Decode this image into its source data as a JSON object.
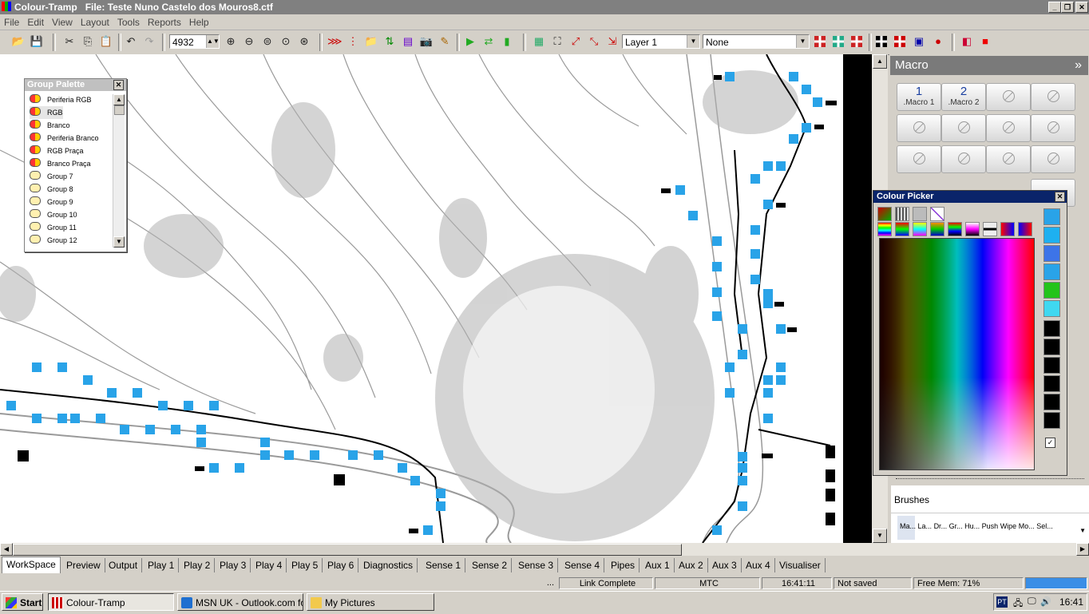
{
  "window": {
    "app_name": "Colour-Tramp",
    "file_label": "File: Teste Nuno Castelo dos Mouros8.ctf"
  },
  "menu": [
    "File",
    "Edit",
    "View",
    "Layout",
    "Tools",
    "Reports",
    "Help"
  ],
  "toolbar": {
    "zoom_value": "4932",
    "layer_value": "Layer 1",
    "filter_value": "None"
  },
  "group_palette": {
    "title": "Group Palette",
    "items": [
      "Periferia RGB",
      "RGB",
      "Branco",
      "Periferia Branco",
      "RGB Praça",
      "Branco Praça",
      "Group 7",
      "Group 8",
      "Group 9",
      "Group 10",
      "Group 11",
      "Group 12"
    ],
    "selected": "RGB"
  },
  "macro_panel": {
    "title": "Macro",
    "collapse_glyph": "»",
    "buttons": [
      {
        "num": "1",
        "label": ".Macro 1"
      },
      {
        "num": "2",
        "label": ".Macro 2"
      }
    ]
  },
  "colour_picker": {
    "title": "Colour Picker",
    "swatches": [
      "#29a3e8",
      "#1eb0f0",
      "#3d74e8",
      "#29a3e8",
      "#22c41a",
      "#3fd8f0",
      "#000000",
      "#000000",
      "#000000",
      "#000000",
      "#000000",
      "#000000"
    ]
  },
  "brushes": {
    "title": "Brushes",
    "items": [
      "Ma...",
      "La...",
      "Dr...",
      "Gr...",
      "Hu...",
      "Push",
      "Wipe",
      "Mo...",
      "Sel..."
    ]
  },
  "tabs": [
    "WorkSpace",
    "Preview",
    "Output",
    "Play 1",
    "Play 2",
    "Play 3",
    "Play 4",
    "Play 5",
    "Play 6",
    "Diagnostics",
    "Sense 1",
    "Sense 2",
    "Sense 3",
    "Sense 4",
    "Pipes",
    "Aux 1",
    "Aux 2",
    "Aux 3",
    "Aux 4",
    "Visualiser"
  ],
  "active_tab": "WorkSpace",
  "status": {
    "ellipsis": "...",
    "link": "Link Complete",
    "sync": "MTC",
    "time": "16:41:11",
    "saved": "Not saved",
    "memory": "Free Mem: 71%"
  },
  "taskbar": {
    "start": "Start",
    "tasks": [
      "Colour-Tramp",
      "MSN UK - Outlook.com fo...",
      "My Pictures"
    ],
    "lang": "PT",
    "clock": "16:41"
  },
  "colors": {
    "lamp": "#29a3e8",
    "title_active": "#0a246a",
    "status_progress": "#3a8ee6"
  }
}
